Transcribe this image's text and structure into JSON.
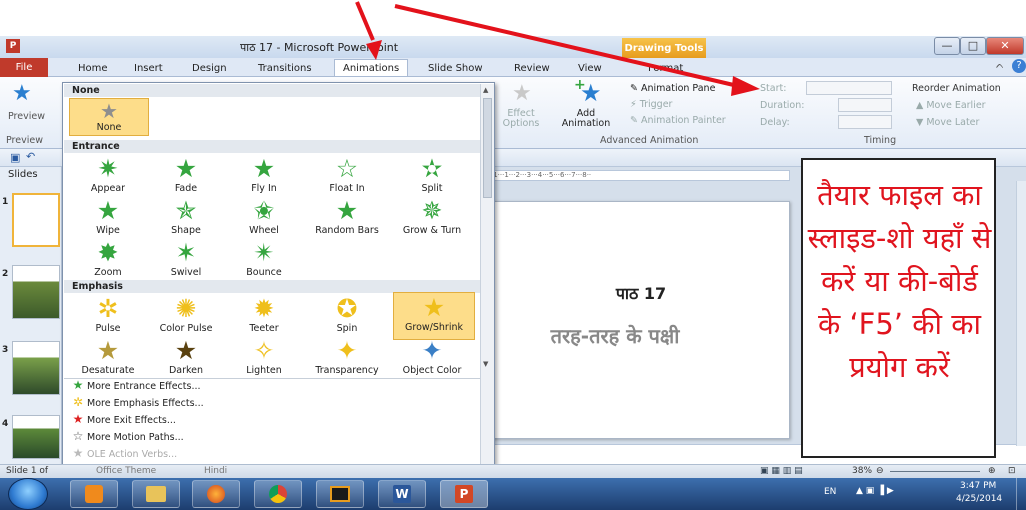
{
  "app": {
    "title": "पाठ 17 - Microsoft PowerPoint",
    "icon_letter": "P",
    "contextual_tab": "Drawing Tools",
    "window_buttons": {
      "minimize": "—",
      "maximize": "□",
      "close": "✕"
    }
  },
  "tabs": [
    "File",
    "Home",
    "Insert",
    "Design",
    "Transitions",
    "Animations",
    "Slide Show",
    "Review",
    "View",
    "Format"
  ],
  "ribbon": {
    "preview": {
      "label": "Preview",
      "group": "Preview"
    },
    "effect_options": "Effect Options",
    "add_animation": "Add Animation",
    "animation_pane": "Animation Pane",
    "trigger": "Trigger",
    "animation_painter": "Animation Painter",
    "advanced_group": "Advanced Animation",
    "start": "Start:",
    "duration": "Duration:",
    "delay": "Delay:",
    "timing_group": "Timing",
    "reorder": "Reorder Animation",
    "move_earlier": "Move Earlier",
    "move_later": "Move Later"
  },
  "gallery": {
    "sections": {
      "none": "None",
      "entrance": "Entrance",
      "emphasis": "Emphasis"
    },
    "none_item": "None",
    "entrance": [
      "Appear",
      "Fade",
      "Fly In",
      "Float In",
      "Split",
      "Wipe",
      "Shape",
      "Wheel",
      "Random Bars",
      "Grow & Turn",
      "Zoom",
      "Swivel",
      "Bounce"
    ],
    "emphasis": [
      "Pulse",
      "Color Pulse",
      "Teeter",
      "Spin",
      "Grow/Shrink",
      "Desaturate",
      "Darken",
      "Lighten",
      "Transparency",
      "Object Color"
    ],
    "more": [
      "More Entrance Effects...",
      "More Emphasis Effects...",
      "More Exit Effects...",
      "More Motion Paths...",
      "OLE Action Verbs..."
    ]
  },
  "slides_pane": {
    "header": "Slides",
    "numbers": [
      "1",
      "2",
      "3",
      "4"
    ]
  },
  "slide": {
    "title": "पाठ 17",
    "subtitle": "तरह-तरह के पक्षी"
  },
  "ruler": "·1···1···2···3···4···5···6···7···8··",
  "callout": "तैयार फाइल का स्लाइड-शो यहाँ से करें या की-बोर्ड के ‘F5’ की का प्रयोग करें",
  "status": {
    "slide": "Slide 1 of",
    "theme": "Office Theme",
    "language": "Hindi",
    "zoom": "38%"
  },
  "taskbar": {
    "lang": "EN",
    "time": "3:47 PM",
    "date": "4/25/2014"
  }
}
